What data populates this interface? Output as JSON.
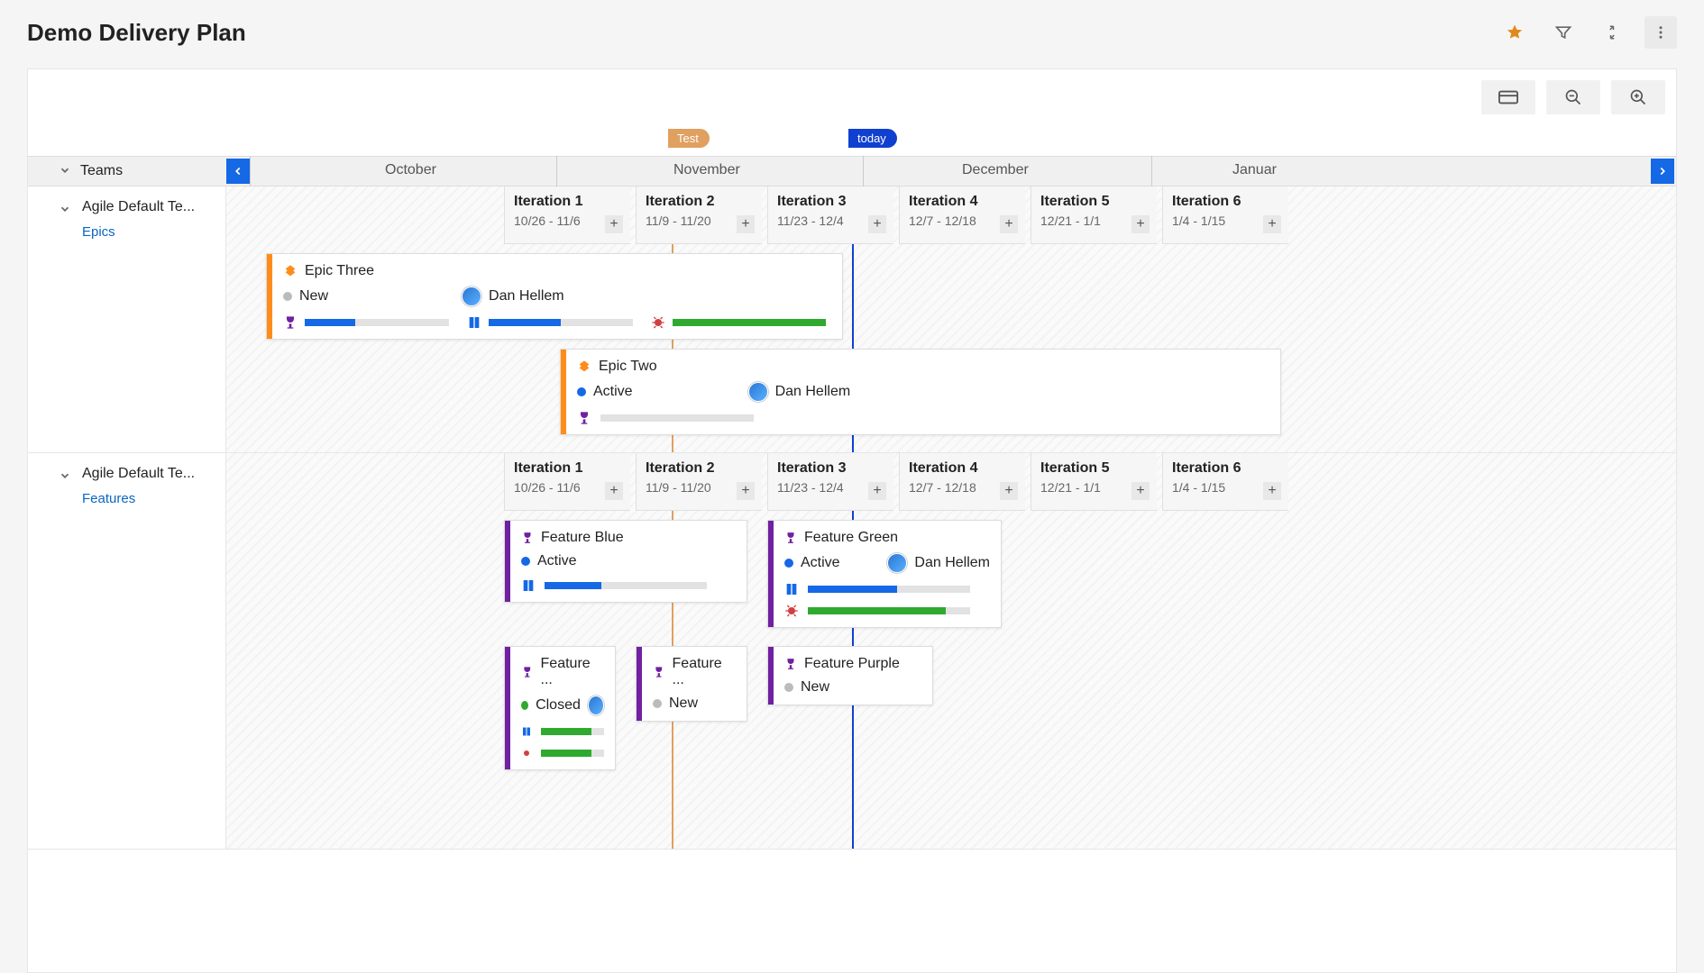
{
  "title": "Demo Delivery Plan",
  "markers": {
    "test": "Test",
    "today": "today"
  },
  "teams_header": "Teams",
  "months": [
    "October",
    "November",
    "December",
    "Januar"
  ],
  "rows": [
    {
      "team": "Agile Default Te...",
      "scope": "Epics",
      "iterations": [
        {
          "name": "Iteration 1",
          "dates": "10/26 - 11/6"
        },
        {
          "name": "Iteration 2",
          "dates": "11/9 - 11/20"
        },
        {
          "name": "Iteration 3",
          "dates": "11/23 - 12/4"
        },
        {
          "name": "Iteration 4",
          "dates": "12/7 - 12/18"
        },
        {
          "name": "Iteration 5",
          "dates": "12/21 - 1/1"
        },
        {
          "name": "Iteration 6",
          "dates": "1/4 - 1/15"
        }
      ],
      "cards": [
        {
          "title": "Epic Three",
          "state": "New",
          "assignee": "Dan Hellem"
        },
        {
          "title": "Epic Two",
          "state": "Active",
          "assignee": "Dan Hellem"
        }
      ]
    },
    {
      "team": "Agile Default Te...",
      "scope": "Features",
      "iterations": [
        {
          "name": "Iteration 1",
          "dates": "10/26 - 11/6"
        },
        {
          "name": "Iteration 2",
          "dates": "11/9 - 11/20"
        },
        {
          "name": "Iteration 3",
          "dates": "11/23 - 12/4"
        },
        {
          "name": "Iteration 4",
          "dates": "12/7 - 12/18"
        },
        {
          "name": "Iteration 5",
          "dates": "12/21 - 1/1"
        },
        {
          "name": "Iteration 6",
          "dates": "1/4 - 1/15"
        }
      ],
      "cards": [
        {
          "title": "Feature Blue",
          "state": "Active",
          "assignee": ""
        },
        {
          "title": "Feature Green",
          "state": "Active",
          "assignee": "Dan Hellem"
        },
        {
          "title": "Feature ...",
          "state": "Closed",
          "assignee": ""
        },
        {
          "title": "Feature ...",
          "state": "New",
          "assignee": ""
        },
        {
          "title": "Feature Purple",
          "state": "New",
          "assignee": ""
        }
      ]
    }
  ],
  "state_colors": {
    "New": "gray",
    "Active": "blue",
    "Closed": "green"
  }
}
